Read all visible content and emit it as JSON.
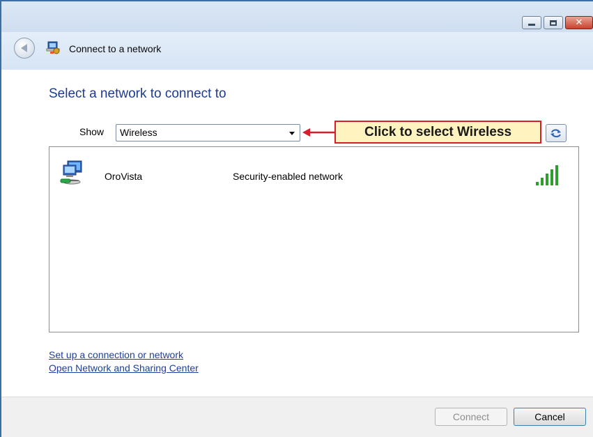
{
  "window": {
    "title": "Connect to a network",
    "controls": [
      "minimize",
      "maximize",
      "close"
    ]
  },
  "main": {
    "heading": "Select a network to connect to",
    "show_label": "Show",
    "show_select_value": "Wireless",
    "callout_text": "Click to select Wireless",
    "networks": [
      {
        "name": "OroVista",
        "security": "Security-enabled network",
        "signal_bars": 5,
        "signal_level": 1.0
      }
    ],
    "links": [
      "Set up a connection or network",
      "Open Network and Sharing Center"
    ]
  },
  "footer": {
    "connect_label": "Connect",
    "cancel_label": "Cancel"
  },
  "colors": {
    "heading": "#1e3b8f",
    "link": "#1e3f9c",
    "callout_fill": "#fff3bf",
    "callout_border": "#d61f2c",
    "signal": "#2e9e2e"
  },
  "icons": {
    "back": "back-arrow-icon",
    "title": "network-connect-icon",
    "network": "wireless-computer-icon",
    "signal": "signal-strength-icon",
    "refresh": "refresh-icon"
  }
}
